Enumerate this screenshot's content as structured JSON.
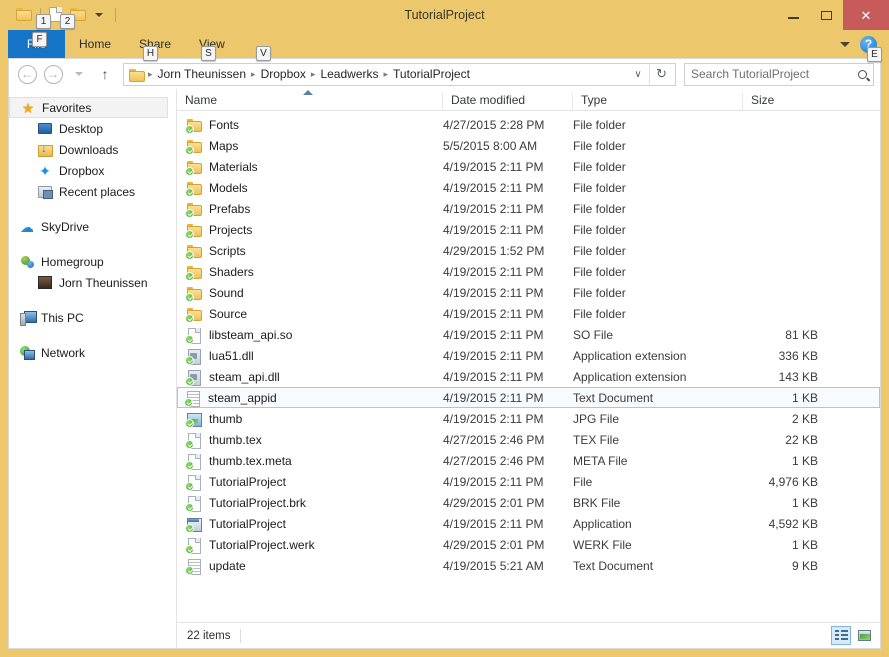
{
  "window": {
    "title": "TutorialProject",
    "minimize_label": "—",
    "maximize_label": "□",
    "close_label": "✕"
  },
  "quick_access": {
    "items": [
      {
        "name": "window-menu-icon",
        "icon": "folder-icon",
        "keytip": ""
      },
      {
        "name": "properties-button",
        "icon": "document-icon",
        "keytip": "1"
      },
      {
        "name": "new-folder-button",
        "icon": "folder-icon",
        "keytip": "2"
      },
      {
        "name": "customize-qat-button",
        "icon": "chevron-down-icon",
        "keytip": ""
      }
    ]
  },
  "ribbon": {
    "tabs": [
      {
        "label": "File",
        "keytip": "F",
        "selected": true
      },
      {
        "label": "Home",
        "keytip": "H",
        "selected": false
      },
      {
        "label": "Share",
        "keytip": "S",
        "selected": false
      },
      {
        "label": "View",
        "keytip": "V",
        "selected": false
      }
    ],
    "expand_label": "▾",
    "help_label": "?",
    "help_keytip": "E"
  },
  "address_bar": {
    "back_label": "←",
    "forward_label": "→",
    "recent_label": "▾",
    "up_label": "↑",
    "breadcrumbs": [
      "Jorn Theunissen",
      "Dropbox",
      "Leadwerks",
      "TutorialProject"
    ],
    "separator": "▸",
    "dropdown_label": "∨",
    "refresh_label": "↻"
  },
  "search": {
    "placeholder": "Search TutorialProject",
    "value": ""
  },
  "sidebar": {
    "groups": [
      {
        "items": [
          {
            "label": "Favorites",
            "icon": "star-icon",
            "indent": false,
            "selected": true
          },
          {
            "label": "Desktop",
            "icon": "desktop-icon",
            "indent": true,
            "selected": false
          },
          {
            "label": "Downloads",
            "icon": "downloads-icon",
            "indent": true,
            "selected": false
          },
          {
            "label": "Dropbox",
            "icon": "dropbox-icon",
            "indent": true,
            "selected": false
          },
          {
            "label": "Recent places",
            "icon": "recent-places-icon",
            "indent": true,
            "selected": false
          }
        ]
      },
      {
        "items": [
          {
            "label": "SkyDrive",
            "icon": "skydrive-icon",
            "indent": false,
            "selected": false
          }
        ]
      },
      {
        "items": [
          {
            "label": "Homegroup",
            "icon": "homegroup-icon",
            "indent": false,
            "selected": false
          },
          {
            "label": "Jorn Theunissen",
            "icon": "avatar-icon",
            "indent": true,
            "selected": false
          }
        ]
      },
      {
        "items": [
          {
            "label": "This PC",
            "icon": "this-pc-icon",
            "indent": false,
            "selected": false
          }
        ]
      },
      {
        "items": [
          {
            "label": "Network",
            "icon": "network-icon",
            "indent": false,
            "selected": false
          }
        ]
      }
    ]
  },
  "file_list": {
    "columns": [
      {
        "label": "Name",
        "sorted": "asc"
      },
      {
        "label": "Date modified",
        "sorted": ""
      },
      {
        "label": "Type",
        "sorted": ""
      },
      {
        "label": "Size",
        "sorted": ""
      }
    ],
    "rows": [
      {
        "name": "Fonts",
        "date": "4/27/2015 2:28 PM",
        "type": "File folder",
        "size": "",
        "icon": "folder",
        "sync": true,
        "selected": false
      },
      {
        "name": "Maps",
        "date": "5/5/2015 8:00 AM",
        "type": "File folder",
        "size": "",
        "icon": "folder",
        "sync": true,
        "selected": false
      },
      {
        "name": "Materials",
        "date": "4/19/2015 2:11 PM",
        "type": "File folder",
        "size": "",
        "icon": "folder",
        "sync": true,
        "selected": false
      },
      {
        "name": "Models",
        "date": "4/19/2015 2:11 PM",
        "type": "File folder",
        "size": "",
        "icon": "folder",
        "sync": true,
        "selected": false
      },
      {
        "name": "Prefabs",
        "date": "4/19/2015 2:11 PM",
        "type": "File folder",
        "size": "",
        "icon": "folder",
        "sync": true,
        "selected": false
      },
      {
        "name": "Projects",
        "date": "4/19/2015 2:11 PM",
        "type": "File folder",
        "size": "",
        "icon": "folder",
        "sync": true,
        "selected": false
      },
      {
        "name": "Scripts",
        "date": "4/29/2015 1:52 PM",
        "type": "File folder",
        "size": "",
        "icon": "folder",
        "sync": true,
        "selected": false
      },
      {
        "name": "Shaders",
        "date": "4/19/2015 2:11 PM",
        "type": "File folder",
        "size": "",
        "icon": "folder",
        "sync": true,
        "selected": false
      },
      {
        "name": "Sound",
        "date": "4/19/2015 2:11 PM",
        "type": "File folder",
        "size": "",
        "icon": "folder",
        "sync": true,
        "selected": false
      },
      {
        "name": "Source",
        "date": "4/19/2015 2:11 PM",
        "type": "File folder",
        "size": "",
        "icon": "folder",
        "sync": true,
        "selected": false
      },
      {
        "name": "libsteam_api.so",
        "date": "4/19/2015 2:11 PM",
        "type": "SO File",
        "size": "81 KB",
        "icon": "doc",
        "sync": true,
        "selected": false
      },
      {
        "name": "lua51.dll",
        "date": "4/19/2015 2:11 PM",
        "type": "Application extension",
        "size": "336 KB",
        "icon": "dll",
        "sync": true,
        "selected": false
      },
      {
        "name": "steam_api.dll",
        "date": "4/19/2015 2:11 PM",
        "type": "Application extension",
        "size": "143 KB",
        "icon": "dll",
        "sync": true,
        "selected": false
      },
      {
        "name": "steam_appid",
        "date": "4/19/2015 2:11 PM",
        "type": "Text Document",
        "size": "1 KB",
        "icon": "txt",
        "sync": true,
        "selected": true
      },
      {
        "name": "thumb",
        "date": "4/19/2015 2:11 PM",
        "type": "JPG File",
        "size": "2 KB",
        "icon": "img",
        "sync": true,
        "selected": false
      },
      {
        "name": "thumb.tex",
        "date": "4/27/2015 2:46 PM",
        "type": "TEX File",
        "size": "22 KB",
        "icon": "doc",
        "sync": true,
        "selected": false
      },
      {
        "name": "thumb.tex.meta",
        "date": "4/27/2015 2:46 PM",
        "type": "META File",
        "size": "1 KB",
        "icon": "doc",
        "sync": true,
        "selected": false
      },
      {
        "name": "TutorialProject",
        "date": "4/19/2015 2:11 PM",
        "type": "File",
        "size": "4,976 KB",
        "icon": "doc",
        "sync": true,
        "selected": false
      },
      {
        "name": "TutorialProject.brk",
        "date": "4/29/2015 2:01 PM",
        "type": "BRK File",
        "size": "1 KB",
        "icon": "doc",
        "sync": true,
        "selected": false
      },
      {
        "name": "TutorialProject",
        "date": "4/19/2015 2:11 PM",
        "type": "Application",
        "size": "4,592 KB",
        "icon": "app",
        "sync": true,
        "selected": false
      },
      {
        "name": "TutorialProject.werk",
        "date": "4/29/2015 2:01 PM",
        "type": "WERK File",
        "size": "1 KB",
        "icon": "doc",
        "sync": true,
        "selected": false
      },
      {
        "name": "update",
        "date": "4/19/2015 5:21 AM",
        "type": "Text Document",
        "size": "9 KB",
        "icon": "txt",
        "sync": true,
        "selected": false
      }
    ]
  },
  "status_bar": {
    "item_count": "22 items",
    "views": [
      {
        "name": "details-view-button",
        "active": true
      },
      {
        "name": "large-icons-view-button",
        "active": false
      }
    ]
  },
  "colors": {
    "window_frame": "#ecc76c",
    "file_tab": "#1675c6",
    "close_button": "#c75b5b",
    "selection_border": "#9fc9e8",
    "selection_fill": "#f7fbfe"
  }
}
